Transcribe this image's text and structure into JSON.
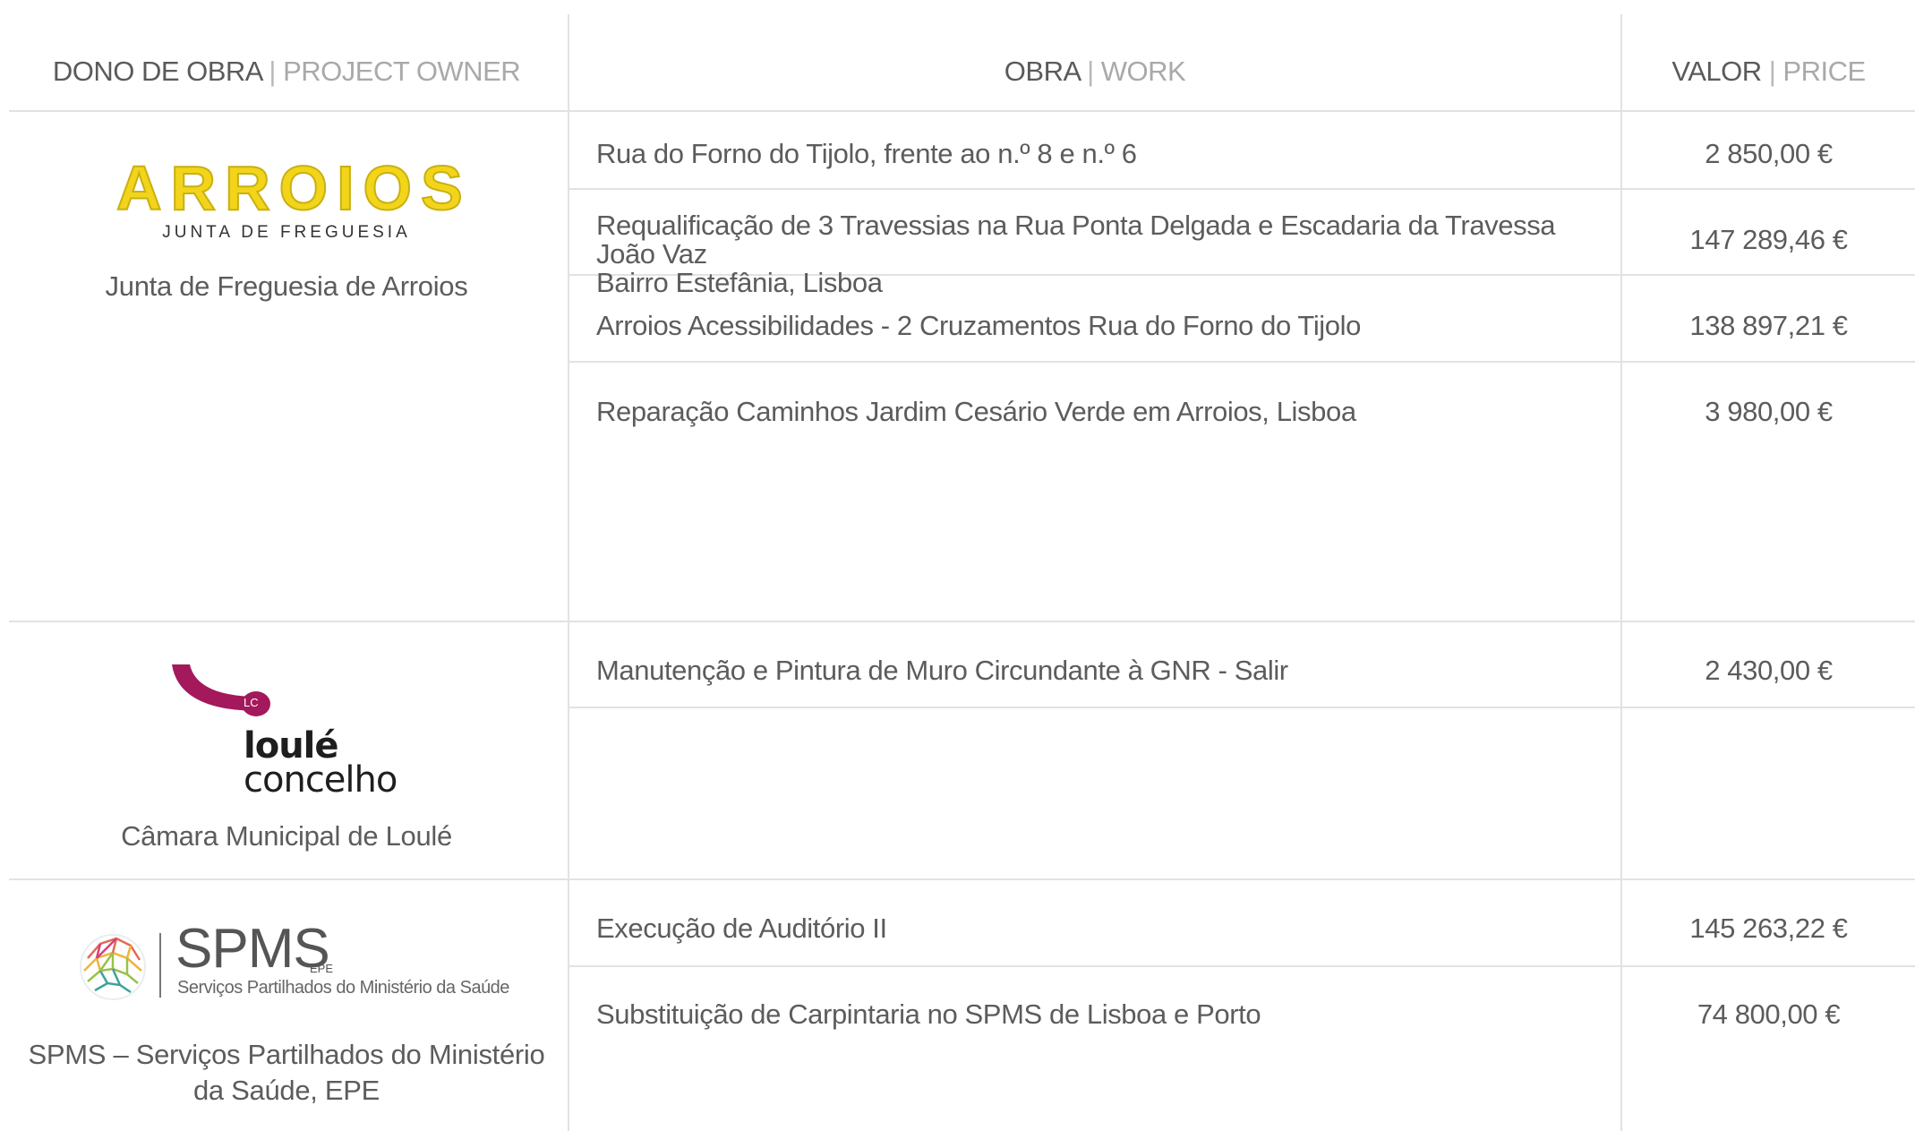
{
  "headers": {
    "owner": {
      "main": "DONO DE OBRA",
      "separator": "|",
      "sub": "PROJECT OWNER"
    },
    "work": {
      "main": "OBRA",
      "separator": "|",
      "sub": "WORK"
    },
    "price": {
      "main": "VALOR",
      "separator": "|",
      "sub": "PRICE"
    }
  },
  "owners": [
    {
      "logo": {
        "word": "ARROIOS",
        "subtitle": "JUNTA DE FREGUESIA",
        "colors": [
          "#f2d51a",
          "#c9b010"
        ]
      },
      "name": "Junta de Freguesia de Arroios",
      "works": [
        {
          "title": "Rua do Forno do Tijolo, frente ao n.º 8 e n.º 6",
          "price": "2 850,00 €"
        },
        {
          "title_line1": "Requalificação de 3 Travessias na Rua Ponta Delgada e Escadaria da Travessa João Vaz",
          "title_line2": "Bairro Estefânia, Lisboa",
          "price": "147 289,46 €"
        },
        {
          "title": "Arroios Acessibilidades - 2 Cruzamentos Rua do Forno do Tijolo",
          "price": "138 897,21 €"
        },
        {
          "title": "Reparação Caminhos Jardim Cesário Verde em Arroios, Lisboa",
          "price": "3  980,00 €"
        }
      ]
    },
    {
      "logo": {
        "badge": "LC",
        "word1": "loulé",
        "word2": "concelho",
        "color": "#a3195b"
      },
      "name": "Câmara Municipal de Loulé",
      "works": [
        {
          "title": "Manutenção e Pintura de Muro Circundante à GNR - Salir",
          "price": "2 430,00 €"
        }
      ]
    },
    {
      "logo": {
        "word": "SPMS",
        "epe": "EPE",
        "subtitle": "Serviços Partilhados do Ministério da Saúde",
        "icon": "colorful-network-globe-icon"
      },
      "name_line1": "SPMS – Serviços Partilhados do Ministério",
      "name_line2": "da Saúde, EPE",
      "works": [
        {
          "title": "Execução de Auditório II",
          "price": "145 263,22 €"
        },
        {
          "title": "Substituição de Carpintaria no SPMS de Lisboa e Porto",
          "price": "74 800,00 €"
        }
      ]
    }
  ]
}
